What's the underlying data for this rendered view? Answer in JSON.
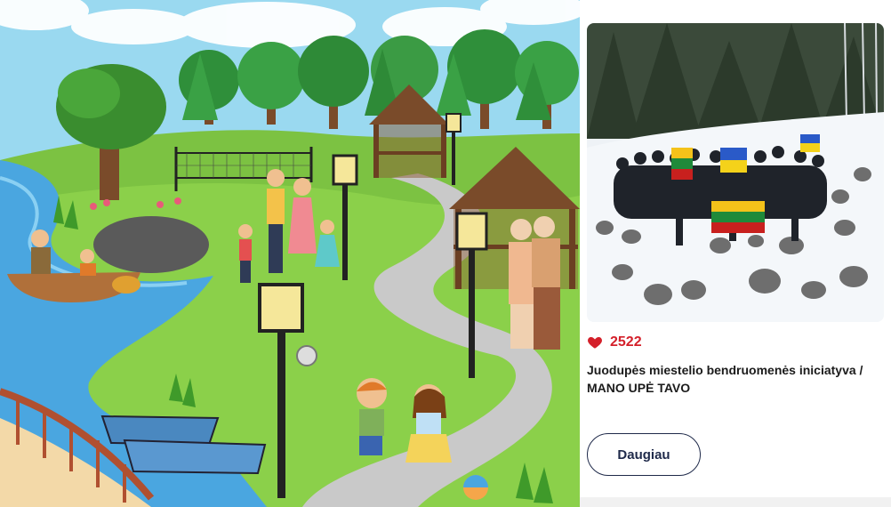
{
  "project": {
    "votes": "2522",
    "title_line1": "Juodupės miestelio bendruomenės iniciatyva /",
    "title_line2": "MANO UPĖ TAVO",
    "more_button": "Daugiau"
  },
  "icons": {
    "vote": "heart-icon"
  },
  "colors": {
    "accent": "#d4202a",
    "button_border": "#1f2a4a"
  }
}
